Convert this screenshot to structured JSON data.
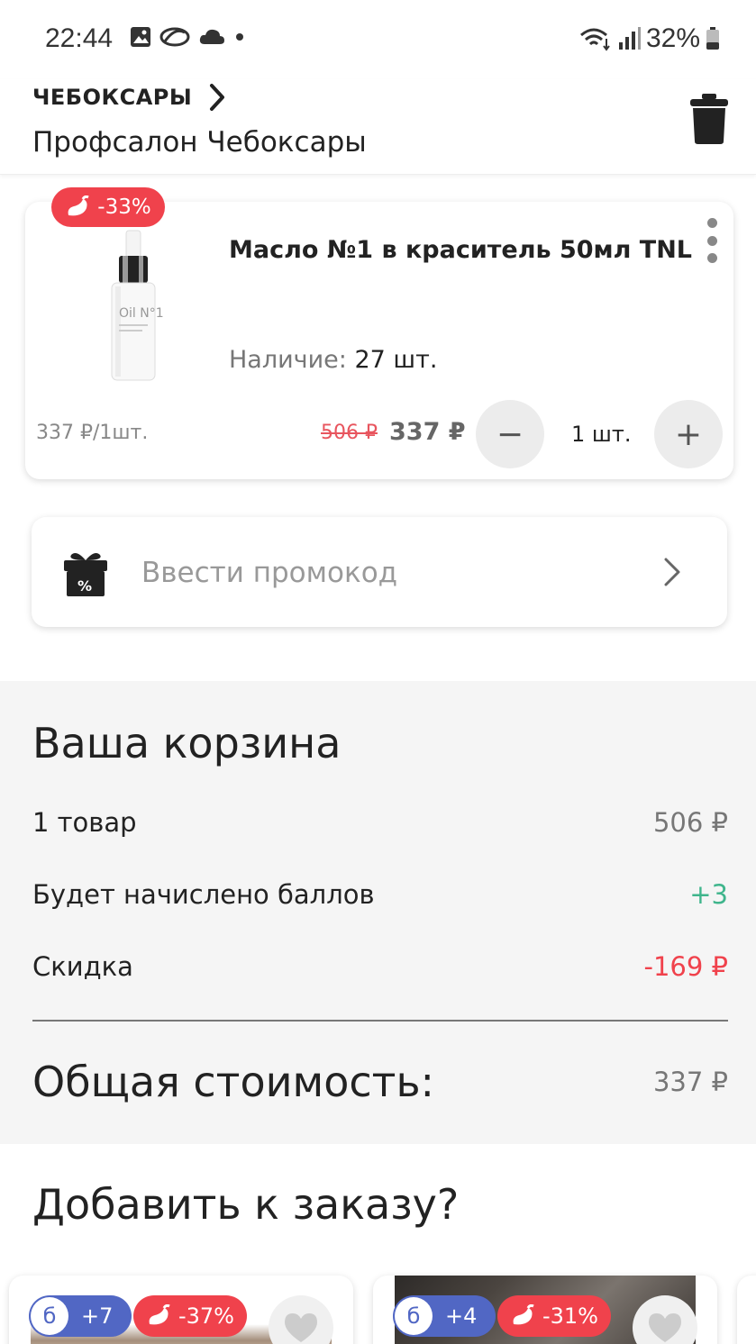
{
  "status_bar": {
    "time": "22:44",
    "battery": "32%",
    "icons": [
      "gallery-icon",
      "app-icon",
      "cloud-icon",
      "dot-icon",
      "wifi-icon",
      "signal-icon",
      "battery-icon"
    ]
  },
  "header": {
    "city": "ЧЕБОКСАРЫ",
    "salon": "Профсалон Чебоксары"
  },
  "cart_item": {
    "discount": "-33%",
    "title": "Масло №1 в краситель 50мл TNL",
    "stock_label": "Наличие:",
    "stock_value": "27 шт.",
    "unit_price": "337 ₽/1шт.",
    "old_price": "506 ₽",
    "new_price": "337 ₽",
    "quantity": "1 шт.",
    "minus": "−",
    "plus": "+"
  },
  "promo": {
    "label": "Ввести промокод"
  },
  "summary": {
    "title": "Ваша корзина",
    "items_label": "1 товар",
    "items_value": "506 ₽",
    "points_label": "Будет начислено баллов",
    "points_value": "+3",
    "discount_label": "Скидка",
    "discount_value": "-169 ₽",
    "total_label": "Общая стоимость:",
    "total_value": "337 ₽"
  },
  "recommendations": {
    "title": "Добавить к заказу?",
    "items": [
      {
        "bonus_letter": "б",
        "bonus": "+7",
        "discount": "-37%"
      },
      {
        "bonus_letter": "б",
        "bonus": "+4",
        "discount": "-31%"
      }
    ]
  },
  "colors": {
    "accent_red": "#f0424c",
    "accent_green": "#3fb58c",
    "bonus_blue": "#5167c4"
  }
}
